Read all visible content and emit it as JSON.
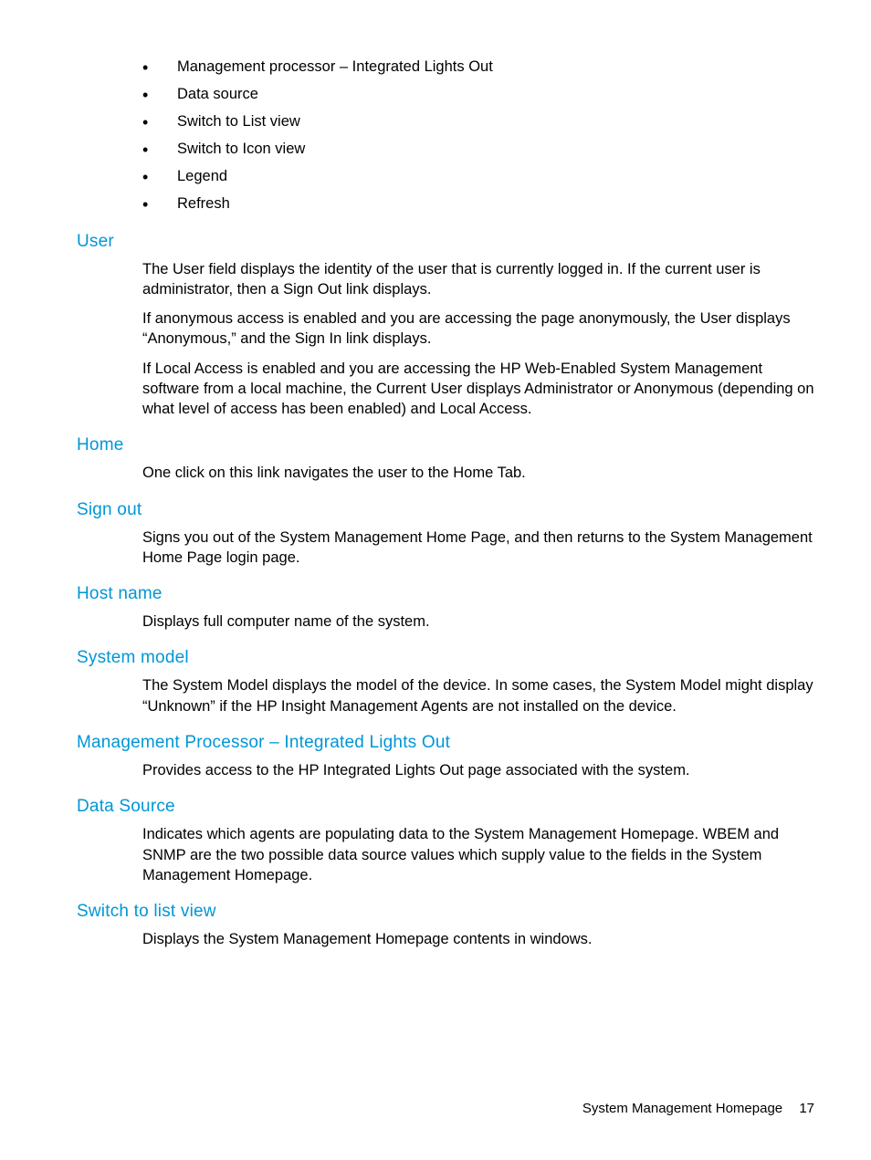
{
  "bullets": [
    "Management processor – Integrated Lights Out",
    "Data source",
    "Switch to List view",
    "Switch to Icon view",
    "Legend",
    "Refresh"
  ],
  "sections": {
    "user": {
      "title": "User",
      "p1": "The User field displays the identity of the user that is currently logged in. If the current user is administrator, then a Sign Out link displays.",
      "p2": "If anonymous access is enabled and you are accessing the page anonymously, the User displays “Anonymous,” and the Sign In link displays.",
      "p3": "If Local Access is enabled and you are accessing the HP Web-Enabled System Management software from a local machine, the Current User displays Administrator or Anonymous (depending on what level of access has been enabled) and Local Access."
    },
    "home": {
      "title": "Home",
      "p1": "One click on this link navigates the user to the Home Tab."
    },
    "signout": {
      "title": "Sign out",
      "p1": "Signs you out of the System Management Home Page, and then returns to the System Management Home Page login page."
    },
    "hostname": {
      "title": "Host name",
      "p1": "Displays full computer name of the system."
    },
    "systemmodel": {
      "title": "System model",
      "p1": "The System Model displays the model of the device. In some cases, the System Model might display “Unknown” if the HP Insight Management Agents are not installed on the device."
    },
    "mgmtproc": {
      "title": "Management Processor – Integrated Lights Out",
      "p1": "Provides access to the HP Integrated Lights Out page associated with the system."
    },
    "datasource": {
      "title": "Data Source",
      "p1": "Indicates which agents are populating data to the System Management Homepage. WBEM and SNMP are the two possible data source values which supply value to the fields in the System Management Homepage."
    },
    "listview": {
      "title": "Switch to list view",
      "p1": "Displays the System Management Homepage contents in windows."
    }
  },
  "footer": {
    "label": "System Management Homepage",
    "page": "17"
  }
}
